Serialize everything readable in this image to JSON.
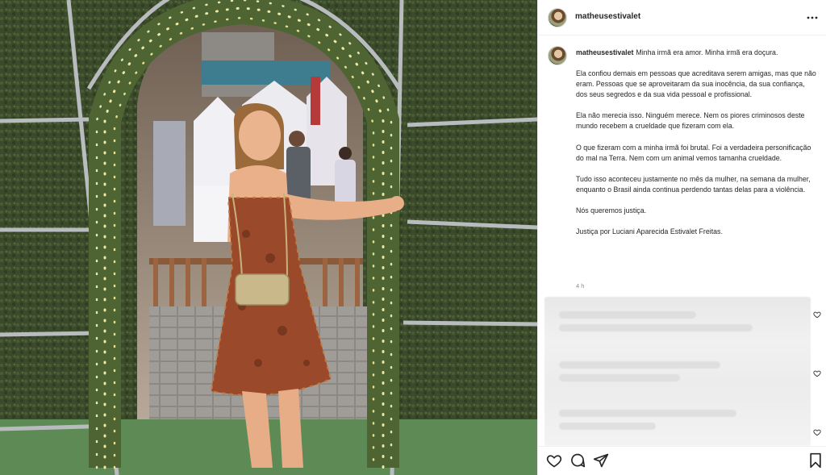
{
  "post": {
    "username": "matheusestivalet",
    "photo_alt": "",
    "caption": {
      "first_line": "Minha irmã era amor. Minha irmã era doçura.",
      "paragraphs": [
        "Ela confiou demais em pessoas que acreditava serem amigas, mas que não eram. Pessoas que se aproveitaram da sua inocência, da sua confiança, dos seus segredos e da sua vida pessoal e profissional.",
        "Ela não merecia isso. Ninguém merece. Nem os piores criminosos deste mundo recebem a crueldade que fizeram com ela.",
        "O que fizeram com a minha irmã foi brutal. Foi a verdadeira personificação do mal na Terra. Nem com um animal vemos tamanha crueldade.",
        "Tudo isso aconteceu justamente no mês da mulher, na semana da mulher, enquanto o Brasil ainda continua perdendo tantas delas para a violência.",
        "Nós queremos justiça.",
        "Justiça por Luciani Aparecida Estivalet Freitas."
      ]
    },
    "time_ago": "4 h"
  },
  "icons": {
    "more": "more-horizontal-icon",
    "like": "heart-icon",
    "comment": "comment-icon",
    "share": "share-icon",
    "save": "bookmark-icon",
    "comment_like": "heart-icon"
  },
  "colors": {
    "text": "#262626",
    "muted": "#8e8e8e",
    "border": "#efefef"
  }
}
